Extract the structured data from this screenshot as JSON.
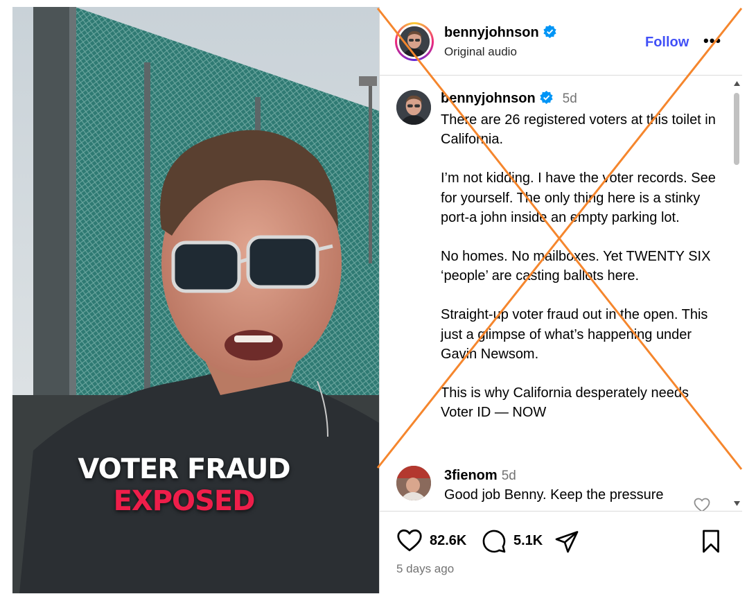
{
  "video": {
    "caption_line1": "VOTER FRAUD",
    "caption_line2": "EXPOSED",
    "caption_color_line2": "#ee1e4a"
  },
  "header": {
    "username": "bennyjohnson",
    "subtitle": "Original audio",
    "follow_label": "Follow",
    "more_label": "•••"
  },
  "caption": {
    "username": "bennyjohnson",
    "time": "5d",
    "paragraphs": [
      "There are 26 registered voters at this toilet in California.",
      "I’m not kidding. I have the voter records. See for yourself. The only thing here is a stinky port-a john inside an empty parking lot.",
      "No homes. No mailboxes. Yet TWENTY SIX ‘people’ are casting ballots here.",
      "Straight-up voter fraud out in the open. This just a glimpse of what’s happening under Gavin Newsom.",
      "This is why California desperately needs Voter ID — NOW"
    ]
  },
  "comment": {
    "username": "3fienom",
    "time": "5d",
    "text": "Good job Benny. Keep the pressure"
  },
  "actions": {
    "likes": "82.6K",
    "comments": "5.1K",
    "posted": "5 days ago",
    "icons": [
      "heart-icon",
      "comment-icon",
      "share-icon",
      "bookmark-icon"
    ]
  },
  "colors": {
    "accent_follow": "#4150f7",
    "verified": "#0095f6",
    "cross_overlay": "#f5862d"
  }
}
